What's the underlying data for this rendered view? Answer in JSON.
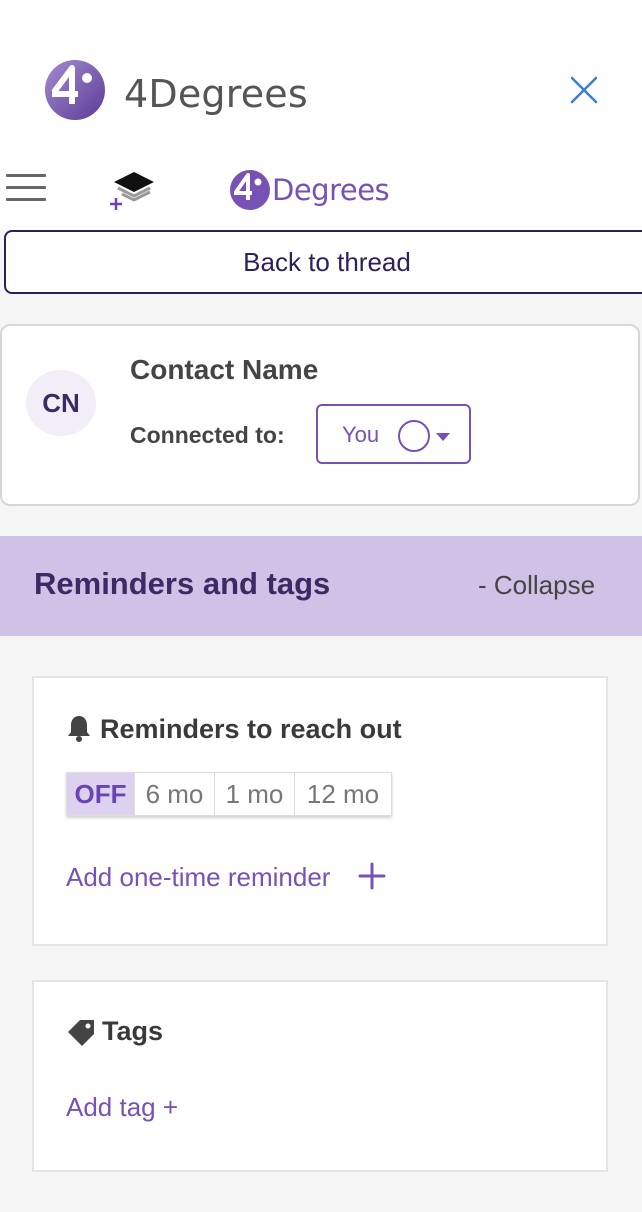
{
  "header": {
    "app_title": "4Degrees",
    "close_icon": "close-icon"
  },
  "toolbar": {
    "menu_icon": "hamburger-menu-icon",
    "layers_icon": "add-layers-icon",
    "brand_text": "Degrees"
  },
  "back_button": {
    "label": "Back to thread"
  },
  "contact": {
    "initials": "CN",
    "name": "Contact Name",
    "connected_label": "Connected to:",
    "connected_value": "You"
  },
  "section": {
    "title": "Reminders and tags",
    "collapse_label": "- Collapse",
    "background": "#cfc2e6"
  },
  "reminders": {
    "title": "Reminders to reach out",
    "options": [
      "OFF",
      "6 mo",
      "1 mo",
      "12 mo"
    ],
    "selected": "OFF",
    "add_label": "Add one-time reminder"
  },
  "tags": {
    "title": "Tags",
    "add_label": "Add tag +"
  },
  "colors": {
    "accent": "#7851b5",
    "dark_purple": "#2c1f5a"
  }
}
